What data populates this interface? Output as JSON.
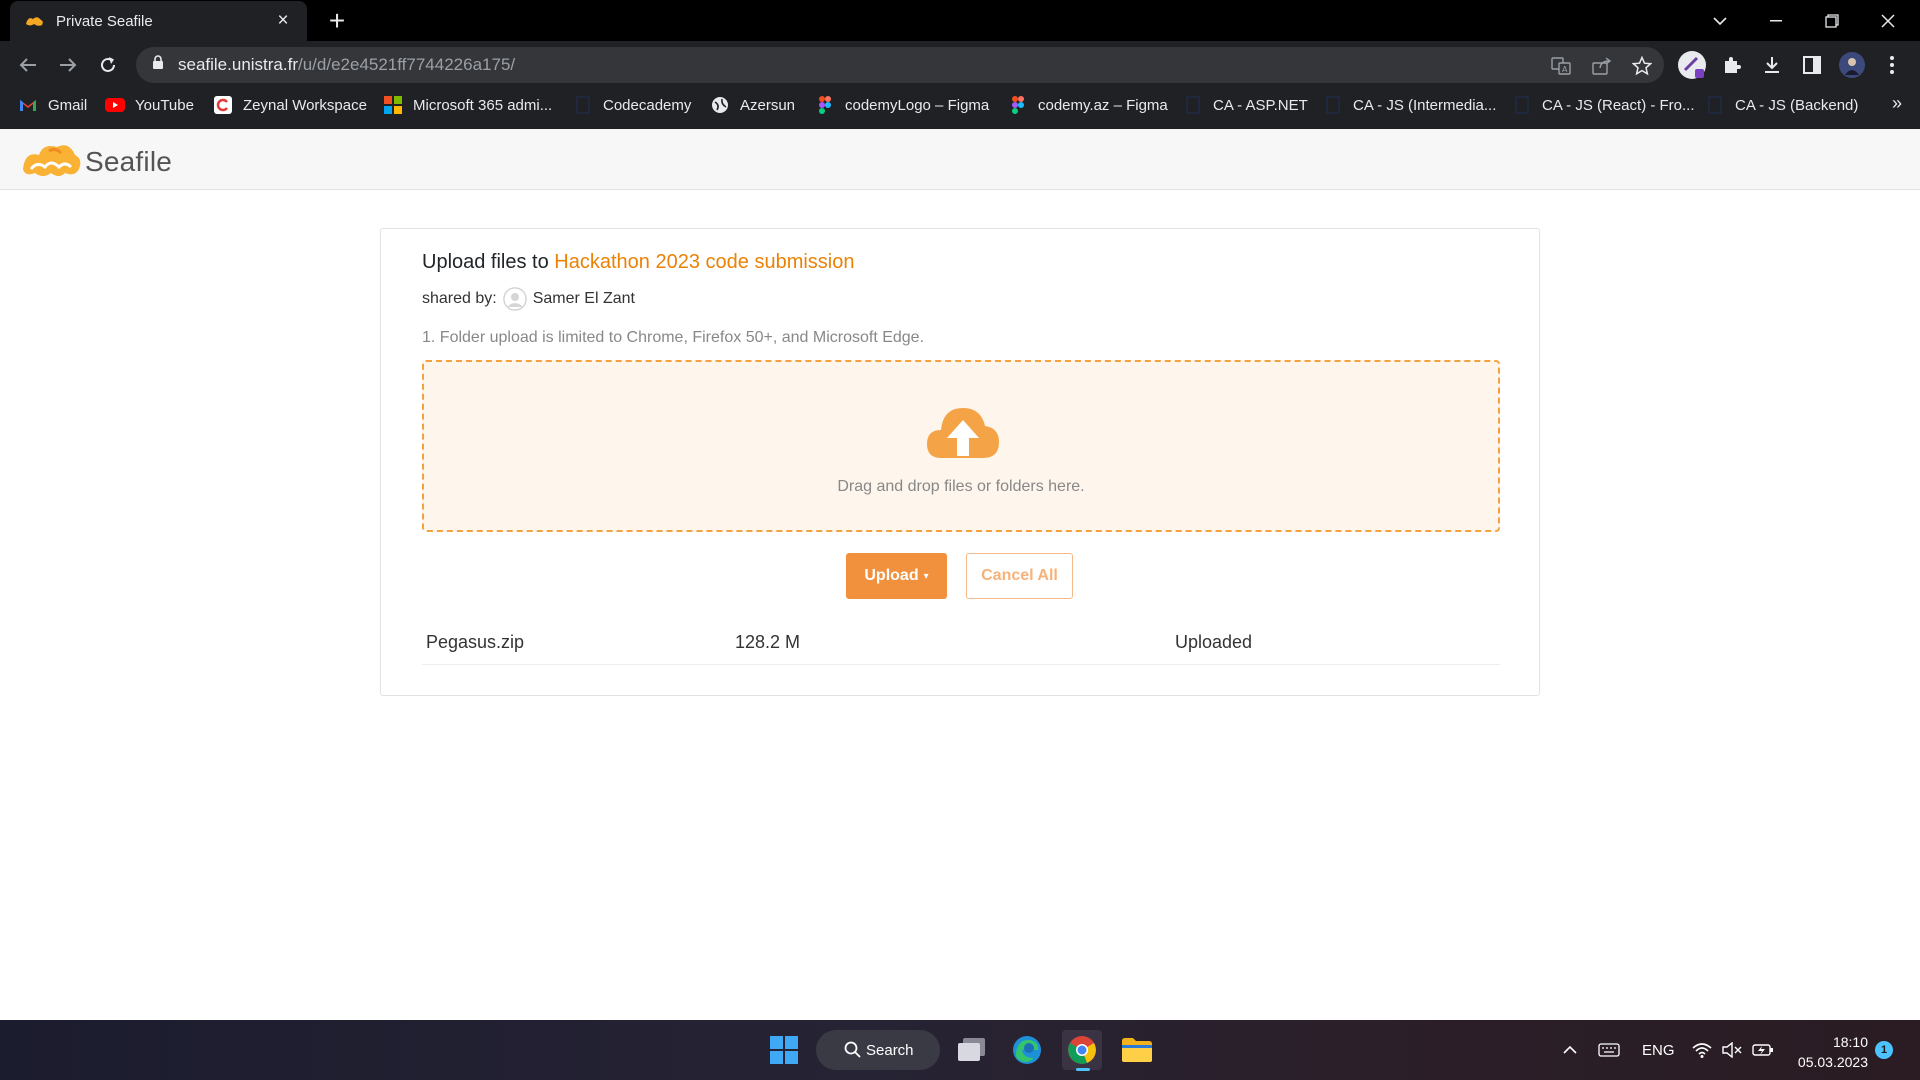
{
  "browser": {
    "tab": {
      "title": "Private Seafile",
      "close": "×"
    },
    "new_tab": "+",
    "url_host": "seafile.unistra.fr",
    "url_path": "/u/d/e2e4521ff7744226a175/"
  },
  "bookmarks": [
    {
      "label": "Gmail",
      "icon": "gmail-icon"
    },
    {
      "label": "YouTube",
      "icon": "youtube-icon"
    },
    {
      "label": "Zeynal Workspace",
      "icon": "workspace-icon"
    },
    {
      "label": "Microsoft 365 admi...",
      "icon": "microsoft-icon"
    },
    {
      "label": "Codecademy",
      "icon": "page-icon"
    },
    {
      "label": "Azersun",
      "icon": "globe-icon"
    },
    {
      "label": "codemyLogo – Figma",
      "icon": "figma-icon"
    },
    {
      "label": "codemy.az – Figma",
      "icon": "figma-icon"
    },
    {
      "label": "CA - ASP.NET",
      "icon": "page-icon"
    },
    {
      "label": "CA - JS (Intermedia...",
      "icon": "page-icon"
    },
    {
      "label": "CA - JS (React) - Fro...",
      "icon": "page-icon"
    },
    {
      "label": "CA - JS (Backend)",
      "icon": "page-icon"
    }
  ],
  "bookmarks_more": "»",
  "seafile": {
    "logo_text": "Seafile",
    "title_prefix": "Upload files to ",
    "repo_name": "Hackathon 2023 code submission",
    "shared_by_label": "shared by:",
    "shared_by_name": "Samer El Zant",
    "tip": "1. Folder upload is limited to Chrome, Firefox 50+, and Microsoft Edge.",
    "dropzone_text": "Drag and drop files or folders here.",
    "upload_button": "Upload",
    "cancel_button": "Cancel All",
    "files": [
      {
        "name": "Pegasus.zip",
        "size": "128.2 M",
        "status": "Uploaded"
      }
    ]
  },
  "taskbar": {
    "search_label": "Search",
    "language": "ENG",
    "time": "18:10",
    "date": "05.03.2023",
    "notifications": "1"
  },
  "colors": {
    "accent": "#eb8205",
    "upload_button": "#f2913d",
    "dropzone_bg": "#fef5ec",
    "dropzone_border": "#f4a23f"
  }
}
